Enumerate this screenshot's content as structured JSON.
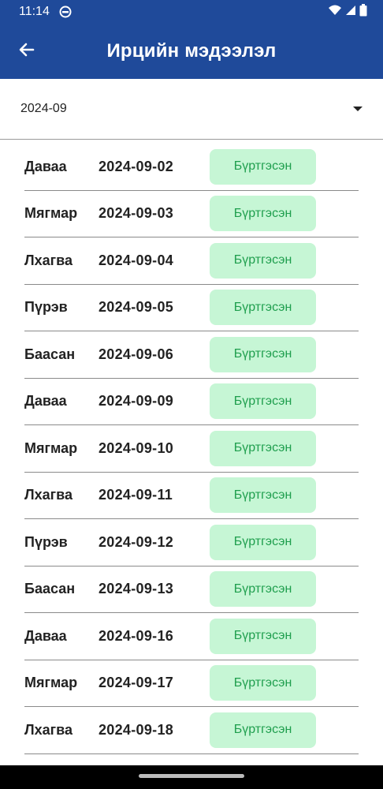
{
  "status_bar": {
    "time": "11:14"
  },
  "app_bar": {
    "title": "Ирцийн мэдээлэл"
  },
  "month_picker": {
    "value": "2024-09"
  },
  "colors": {
    "primary": "#1f4a9a",
    "badge_bg": "#c6f6d5",
    "badge_text": "#1e9e4d"
  },
  "rows": [
    {
      "day": "Даваа",
      "date": "2024-09-02",
      "status": "Бүртгэсэн"
    },
    {
      "day": "Мягмар",
      "date": "2024-09-03",
      "status": "Бүртгэсэн"
    },
    {
      "day": "Лхагва",
      "date": "2024-09-04",
      "status": "Бүртгэсэн"
    },
    {
      "day": "Пүрэв",
      "date": "2024-09-05",
      "status": "Бүртгэсэн"
    },
    {
      "day": "Баасан",
      "date": "2024-09-06",
      "status": "Бүртгэсэн"
    },
    {
      "day": "Даваа",
      "date": "2024-09-09",
      "status": "Бүртгэсэн"
    },
    {
      "day": "Мягмар",
      "date": "2024-09-10",
      "status": "Бүртгэсэн"
    },
    {
      "day": "Лхагва",
      "date": "2024-09-11",
      "status": "Бүртгэсэн"
    },
    {
      "day": "Пүрэв",
      "date": "2024-09-12",
      "status": "Бүртгэсэн"
    },
    {
      "day": "Баасан",
      "date": "2024-09-13",
      "status": "Бүртгэсэн"
    },
    {
      "day": "Даваа",
      "date": "2024-09-16",
      "status": "Бүртгэсэн"
    },
    {
      "day": "Мягмар",
      "date": "2024-09-17",
      "status": "Бүртгэсэн"
    },
    {
      "day": "Лхагва",
      "date": "2024-09-18",
      "status": "Бүртгэсэн"
    }
  ]
}
